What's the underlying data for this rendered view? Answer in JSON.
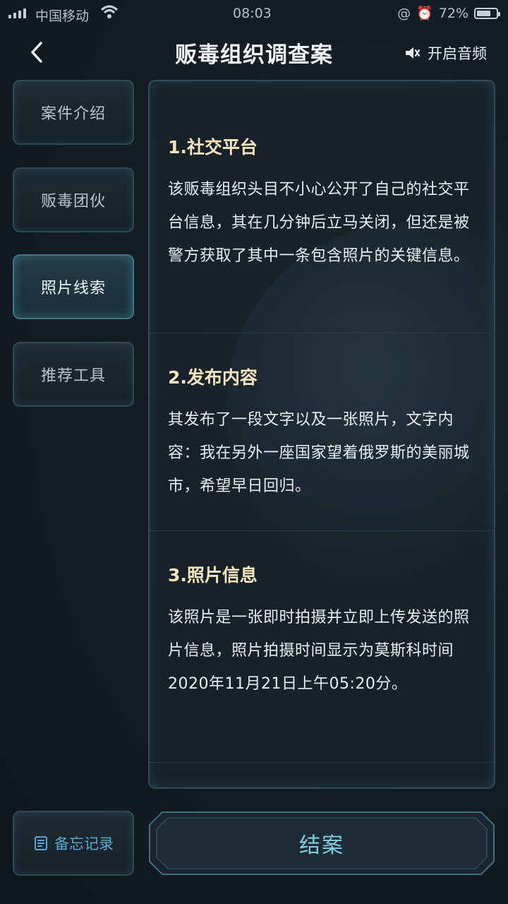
{
  "status_bar": {
    "carrier": "中国移动",
    "time": "08:03",
    "battery": "72%",
    "battery_level": 0.72
  },
  "header": {
    "title": "贩毒组织调查案",
    "audio_label": "开启音频"
  },
  "nav": {
    "items": [
      {
        "label": "案件介绍",
        "active": false
      },
      {
        "label": "贩毒团伙",
        "active": false
      },
      {
        "label": "照片线索",
        "active": true
      },
      {
        "label": "推荐工具",
        "active": false
      }
    ]
  },
  "content": {
    "sections": [
      {
        "title": "1.社交平台",
        "body": "该贩毒组织头目不小心公开了自己的社交平台信息，其在几分钟后立马关闭，但还是被警方获取了其中一条包含照片的关键信息。"
      },
      {
        "title": "2.发布内容",
        "body": "其发布了一段文字以及一张照片，文字内容：我在另外一座国家望着俄罗斯的美丽城市，希望早日回归。"
      },
      {
        "title": "3.照片信息",
        "body": "该照片是一张即时拍摄并立即上传发送的照片信息，照片拍摄时间显示为莫斯科时间2020年11月21日上午05:20分。"
      }
    ]
  },
  "footer": {
    "memo_label": "备忘记录",
    "close_case_label": "结案"
  },
  "colors": {
    "accent": "#7fd1de",
    "heading": "#f6e6bf",
    "memo": "#58a9cf"
  }
}
